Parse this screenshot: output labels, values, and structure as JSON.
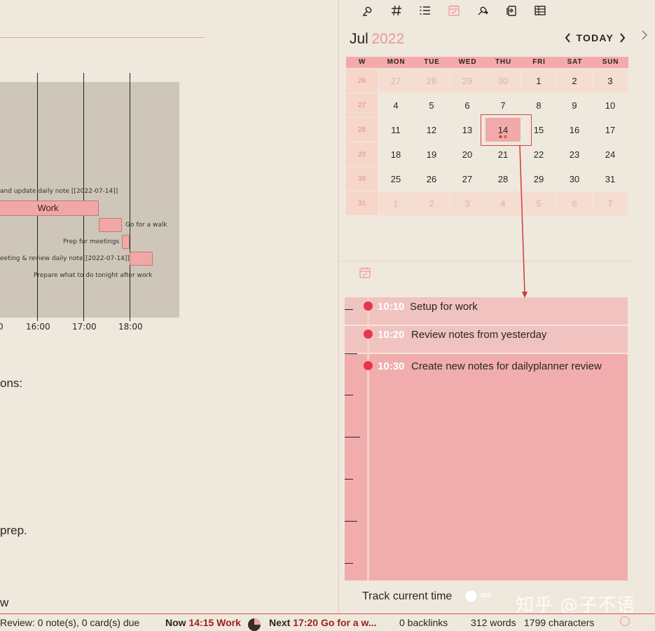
{
  "editor": {
    "gantt": {
      "bar_work": "Work",
      "labels": [
        "and update daily note [[2022-07-14]]",
        "Go for a walk",
        "Prep for meetings",
        "eeting & review daily note[[2022-07-14]]",
        "Prepare what to do tonight after work"
      ],
      "ticks": [
        "0",
        "16:00",
        "17:00",
        "18:00"
      ]
    },
    "text_1": "ons:",
    "text_2": "prep.",
    "text_3": "w"
  },
  "calendar": {
    "month": "Jul",
    "year": "2022",
    "today_label": "TODAY",
    "dow": [
      "W",
      "MON",
      "TUE",
      "WED",
      "THU",
      "FRI",
      "SAT",
      "SUN"
    ],
    "weeks": [
      {
        "wk": "26",
        "days": [
          "27",
          "28",
          "29",
          "30",
          "1",
          "2",
          "3"
        ]
      },
      {
        "wk": "27",
        "days": [
          "4",
          "5",
          "6",
          "7",
          "8",
          "9",
          "10"
        ]
      },
      {
        "wk": "28",
        "days": [
          "11",
          "12",
          "13",
          "14",
          "15",
          "16",
          "17"
        ]
      },
      {
        "wk": "29",
        "days": [
          "18",
          "19",
          "20",
          "21",
          "22",
          "23",
          "24"
        ]
      },
      {
        "wk": "30",
        "days": [
          "25",
          "26",
          "27",
          "28",
          "29",
          "30",
          "31"
        ]
      },
      {
        "wk": "31",
        "days": [
          "1",
          "2",
          "3",
          "4",
          "5",
          "6",
          "7"
        ]
      }
    ]
  },
  "timeline": {
    "items": [
      {
        "time": "10:10",
        "title": "Setup for work"
      },
      {
        "time": "10:20",
        "title": "Review notes from yesterday"
      },
      {
        "time": "10:30",
        "title": "Create new notes for dailyplanner review"
      }
    ],
    "track_label": "Track current time",
    "toggle_state": "OFF"
  },
  "watermark": "知乎 @子不语",
  "status": {
    "review": "Review: 0 note(s), 0 card(s) due",
    "now_label": "Now",
    "now_value": "14:15 Work",
    "next_label": "Next",
    "next_value": "17:20 Go for a w...",
    "backlinks": "0 backlinks",
    "words": "312 words",
    "chars": "1799 characters"
  },
  "colors": {
    "accent": "#f1adad",
    "dot": "#e8334c",
    "year": "#ef9494",
    "background": "#efe8dc"
  }
}
